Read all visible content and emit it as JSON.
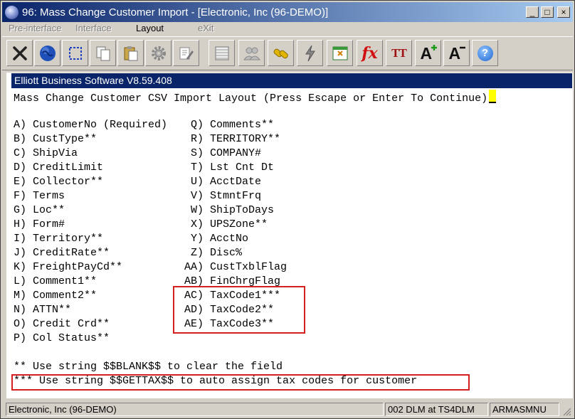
{
  "window": {
    "title": "96: Mass Change Customer Import - [Electronic, Inc (96-DEMO)]",
    "min": "_",
    "max": "□",
    "close": "×"
  },
  "menu": [
    {
      "label": "Pre-interface",
      "enabled": false
    },
    {
      "label": "Interface",
      "enabled": false
    },
    {
      "label": "Layout",
      "enabled": true
    },
    {
      "label": "eXit",
      "enabled": false
    }
  ],
  "toolbar": {
    "icons": [
      "close-x-icon",
      "globe-icon",
      "select-box-icon",
      "copy-icon",
      "paste-icon",
      "gear-icon",
      "edit-form-icon",
      "list-icon",
      "users-icon",
      "link-icon",
      "lightning-icon",
      "calc-sheet-icon",
      "fx-icon",
      "font-size-icon",
      "font-increase-icon",
      "font-decrease-icon",
      "help-icon"
    ],
    "fx_label": "fx",
    "tt_label": "TT",
    "a_label": "A",
    "help_label": "?"
  },
  "terminal": {
    "header": "Elliott Business Software V8.59.408",
    "prompt": "Mass Change Customer CSV Import Layout (Press Escape or Enter To Continue)",
    "left_fields": [
      "A) CustomerNo (Required)",
      "B) CustType**",
      "C) ShipVia",
      "D) CreditLimit",
      "E) Collector**",
      "F) Terms",
      "G) Loc**",
      "H) Form#",
      "I) Territory**",
      "J) CreditRate**",
      "K) FreightPayCd**",
      "L) Comment1**",
      "M) Comment2**",
      "N) ATTN**",
      "O) Credit Crd**",
      "P) Col Status**"
    ],
    "right_fields": [
      " Q) Comments**",
      " R) TERRITORY**",
      " S) COMPANY#",
      " T) Lst Cnt Dt",
      " U) AcctDate",
      " V) StmntFrq",
      " W) ShipToDays",
      " X) UPSZone**",
      " Y) AcctNo",
      " Z) Disc%",
      "AA) CustTxblFlag",
      "AB) FinChrgFlag",
      "AC) TaxCode1***",
      "AD) TaxCode2**",
      "AE) TaxCode3**"
    ],
    "note1": "** Use string $$BLANK$$ to clear the field",
    "note2": "*** Use string $$GETTAX$$ to auto assign tax codes for customer"
  },
  "status": {
    "company": "Electronic, Inc (96-DEMO)",
    "session": "002 DLM at TS4DLM",
    "user": "ARMASMNU"
  },
  "colors": {
    "title_bar": "#0a246a",
    "highlight_box": "#d62020",
    "cursor": "#ffff00"
  }
}
